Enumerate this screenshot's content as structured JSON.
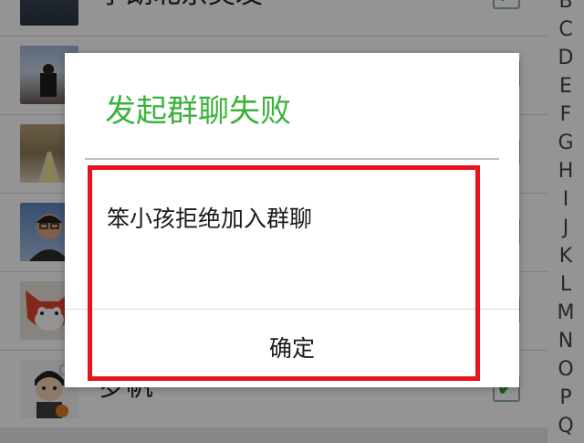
{
  "contacts": [
    {
      "name": "李朗北京美发",
      "checked": true,
      "avatar": "photo-person-dark"
    },
    {
      "name": "",
      "checked": false,
      "avatar": "photo-person-outdoor"
    },
    {
      "name": "",
      "checked": false,
      "avatar": "photo-street"
    },
    {
      "name": "",
      "checked": false,
      "avatar": "photo-man-glasses"
    },
    {
      "name": "",
      "checked": false,
      "avatar": "cartoon-fox"
    },
    {
      "name": "罗帆",
      "checked": true,
      "avatar": "cartoon-basketball-boy"
    }
  ],
  "check_mark": "✔",
  "index_letters": [
    "B",
    "C",
    "D",
    "E",
    "F",
    "G",
    "H",
    "I",
    "J",
    "K",
    "L",
    "M",
    "N",
    "O",
    "P",
    "Q"
  ],
  "dialog": {
    "title": "发起群聊失败",
    "message": "笨小孩拒绝加入群聊",
    "confirm_label": "确定"
  },
  "colors": {
    "title_green": "#3cb23c",
    "highlight_red": "#e8141c"
  }
}
